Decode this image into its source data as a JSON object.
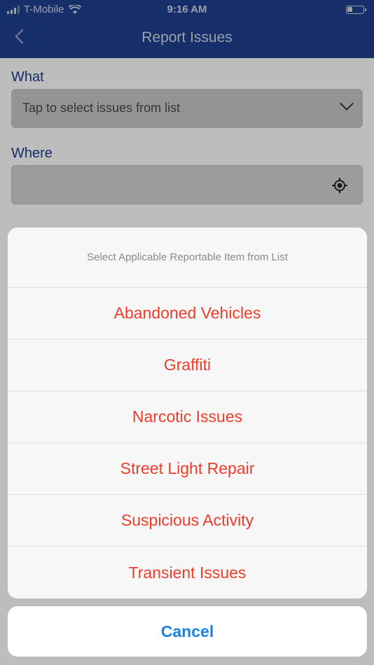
{
  "status_bar": {
    "carrier": "T-Mobile",
    "time": "9:16 AM"
  },
  "nav": {
    "title": "Report Issues",
    "back_icon": "chevron-left-icon"
  },
  "form": {
    "what_label": "What",
    "what_placeholder": "Tap to select issues from list",
    "where_label": "Where",
    "where_value": "",
    "locate_icon": "crosshair-icon"
  },
  "action_sheet": {
    "title": "Select Applicable Reportable Item from List",
    "options": [
      "Abandoned Vehicles",
      "Graffiti",
      "Narcotic Issues",
      "Street Light Repair",
      "Suspicious Activity",
      "Transient Issues"
    ],
    "cancel_label": "Cancel"
  },
  "colors": {
    "nav_background": "#1d3d8a",
    "label_blue": "#1a3a86",
    "option_red": "#f03c2a",
    "cancel_blue": "#1a82e6"
  }
}
